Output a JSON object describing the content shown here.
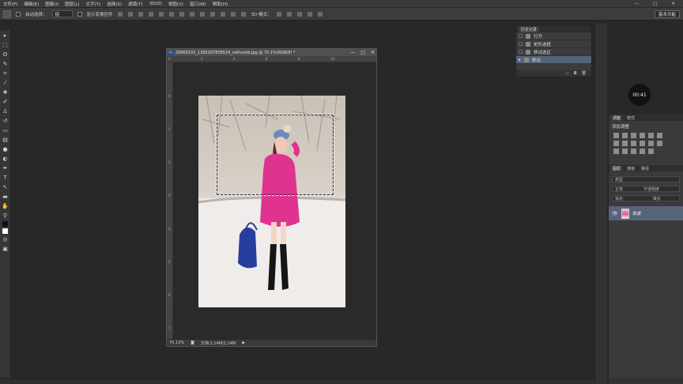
{
  "menu": {
    "items": [
      "文件(F)",
      "编辑(E)",
      "图像(I)",
      "图层(L)",
      "文字(Y)",
      "选择(S)",
      "滤镜(T)",
      "3D(D)",
      "视图(V)",
      "窗口(W)",
      "帮助(H)"
    ],
    "window_controls": [
      "—",
      "□",
      "✕"
    ]
  },
  "options": {
    "auto_select_label": "自动选择：",
    "auto_select_value": "组",
    "show_transform_label": "显示变换控件",
    "mode_label": "3D 模式：",
    "workspace": "基本功能"
  },
  "document": {
    "title": "28960155_1385307838524_nothumb.jpg @ 75.1%(RGB/8) *",
    "ps_badge": "Ps",
    "zoom": "75.13%",
    "docsize": "文档:1.14M/1.14M",
    "ruler_top": [
      "0",
      "1",
      "2",
      "3",
      "4",
      "5",
      "6",
      "7",
      "8",
      "9",
      "10"
    ],
    "ruler_left": [
      "0",
      "1",
      "2",
      "3",
      "4",
      "5",
      "6",
      "7"
    ]
  },
  "history": {
    "tab": "历史记录",
    "items": [
      {
        "label": "打开",
        "active": false
      },
      {
        "label": "矩形选框",
        "active": false
      },
      {
        "label": "移动选区",
        "active": false
      },
      {
        "label": "移动",
        "active": true
      }
    ]
  },
  "timer": "00:41",
  "adjustments": {
    "tabs": [
      "调整",
      "样式"
    ],
    "add_label": "添加调整"
  },
  "layers": {
    "tabs": [
      "图层",
      "通道",
      "路径"
    ],
    "kind": "类型",
    "blend": "正常",
    "opacity": "不透明度",
    "lock": "锁定:",
    "fill": "填充",
    "layer_name": "背景"
  },
  "accent_colors": {
    "selection": "#56647a",
    "badge": "#1c4e8a"
  }
}
